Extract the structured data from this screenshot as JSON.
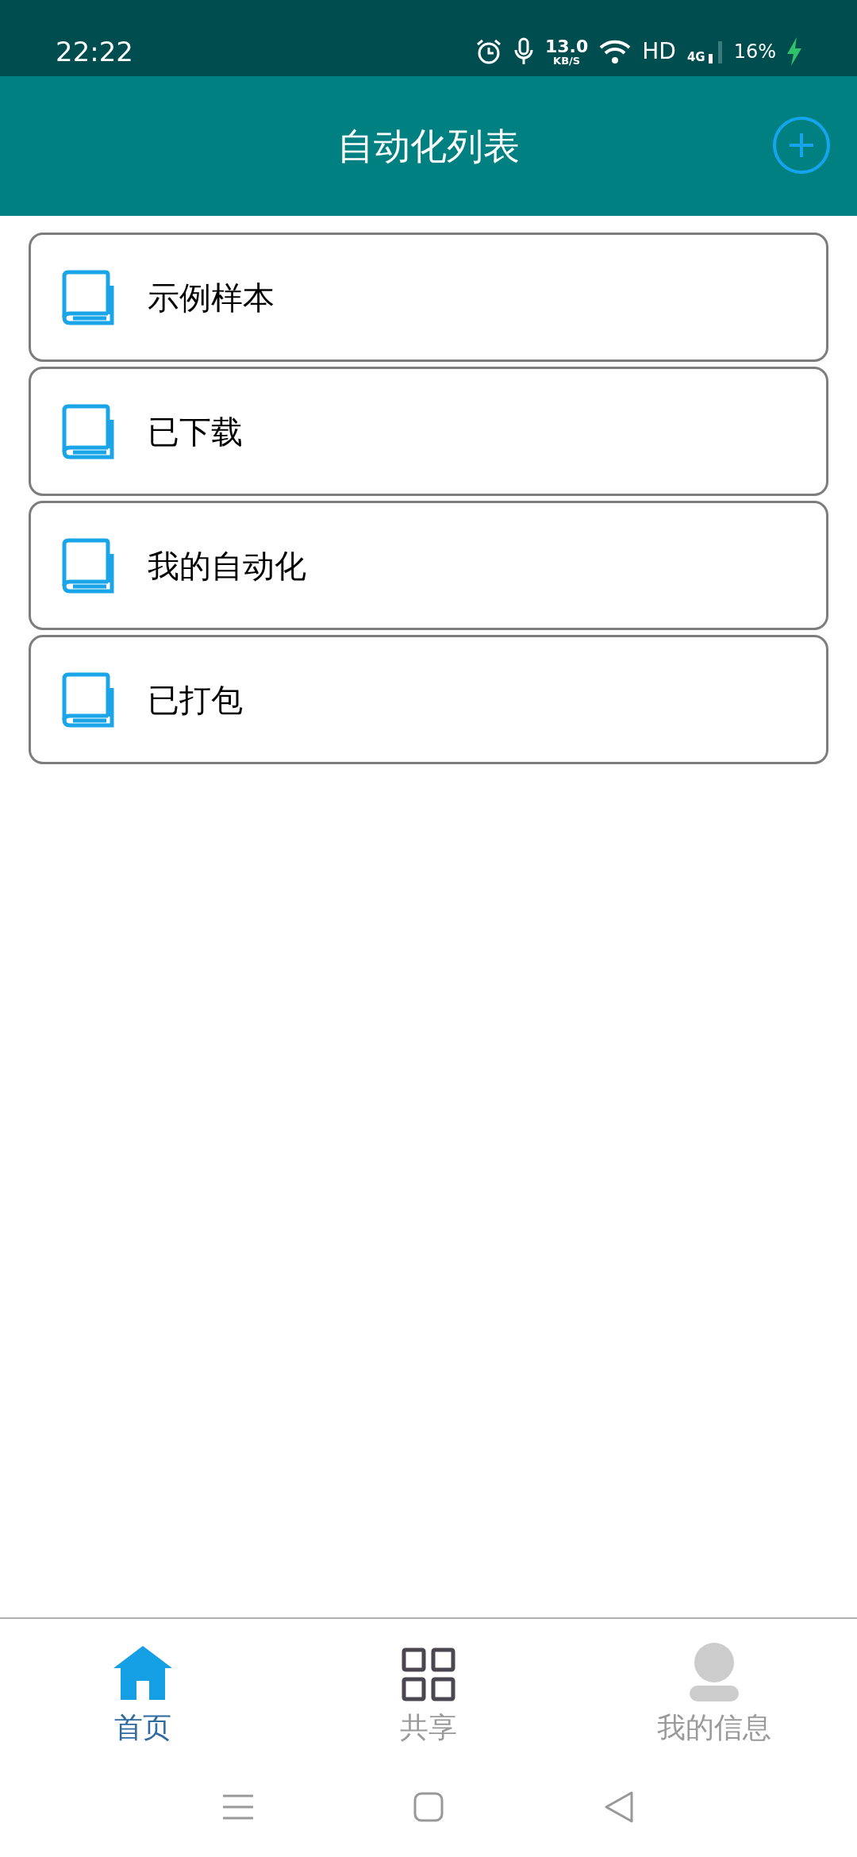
{
  "status_bar": {
    "time": "22:22",
    "speed": "13.0",
    "speed_unit": "KB/S",
    "hd": "HD",
    "network": "4G",
    "battery": "16%"
  },
  "header": {
    "title": "自动化列表"
  },
  "list": [
    {
      "label": "示例样本"
    },
    {
      "label": "已下载"
    },
    {
      "label": "我的自动化"
    },
    {
      "label": "已打包"
    }
  ],
  "tabs": [
    {
      "label": "首页",
      "kind": "home",
      "selected": true
    },
    {
      "label": "共享",
      "kind": "grid",
      "selected": false
    },
    {
      "label": "我的信息",
      "kind": "person",
      "selected": false
    }
  ]
}
